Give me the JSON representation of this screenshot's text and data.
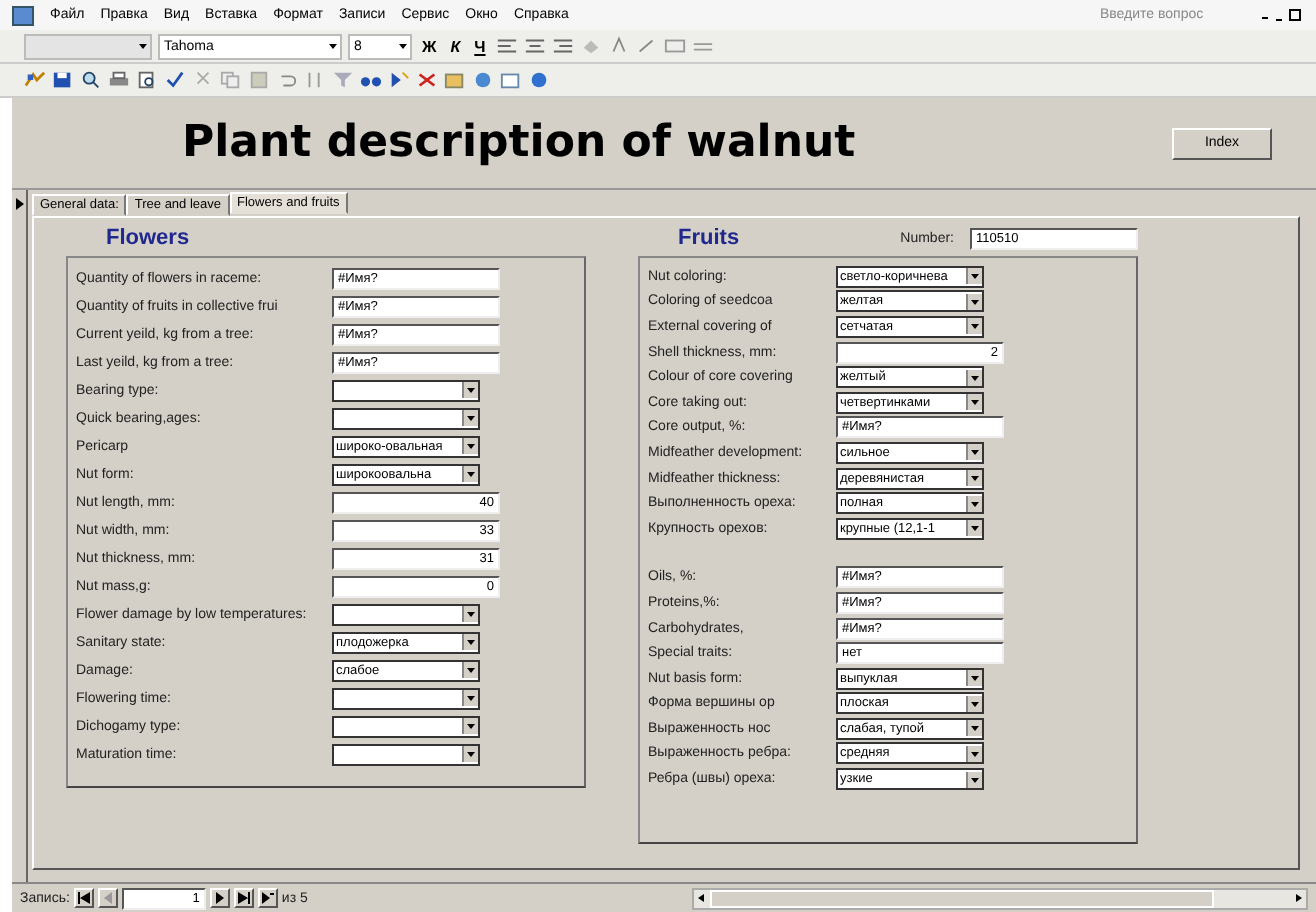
{
  "menu": [
    "Файл",
    "Правка",
    "Вид",
    "Вставка",
    "Формат",
    "Записи",
    "Сервис",
    "Окно",
    "Справка"
  ],
  "help_box": {
    "placeholder": "Введите вопрос"
  },
  "format_toolbar": {
    "font": "Tahoma",
    "size": "8",
    "style_buttons": [
      "Ж",
      "К",
      "Ч"
    ]
  },
  "form": {
    "title": "Plant description of walnut",
    "index_button": "Index",
    "tabs": [
      {
        "label": "General data:",
        "selected": false
      },
      {
        "label": "Tree and leave",
        "selected": false
      },
      {
        "label": "Flowers and fruits",
        "selected": true
      }
    ],
    "number": {
      "label": "Number:",
      "value": "110510"
    },
    "flowers": {
      "heading": "Flowers",
      "fields": [
        {
          "label": "Quantity of flowers in raceme:",
          "kind": "text",
          "value": "#Имя?"
        },
        {
          "label": "Quantity of fruits in collective frui",
          "kind": "text",
          "value": "#Имя?"
        },
        {
          "label": "Current yeild, kg from a tree:",
          "kind": "text",
          "value": "#Имя?"
        },
        {
          "label": "Last yeild, kg from a tree:",
          "kind": "text",
          "value": "#Имя?"
        },
        {
          "label": "Bearing type:",
          "kind": "combo"
        },
        {
          "label": "Quick bearing,ages:",
          "kind": "combo"
        },
        {
          "label": "Pericarp",
          "kind": "combo",
          "value": "широко-овальная"
        },
        {
          "label": "Nut form:",
          "kind": "combo",
          "value": "широкоовальна"
        },
        {
          "label": "Nut length, mm:",
          "kind": "number",
          "value": "40"
        },
        {
          "label": "Nut width, mm:",
          "kind": "number",
          "value": "33"
        },
        {
          "label": "Nut thickness, mm:",
          "kind": "number",
          "value": "31"
        },
        {
          "label": "Nut mass,g:",
          "kind": "number",
          "value": "0"
        },
        {
          "label": "Flower damage by low temperatures:",
          "kind": "combo"
        },
        {
          "label": "Sanitary state:",
          "kind": "combo",
          "value": "плодожерка"
        },
        {
          "label": "Damage:",
          "kind": "combo",
          "value": "слабое"
        },
        {
          "label": "Flowering time:",
          "kind": "combo"
        },
        {
          "label": "Dichogamy type:",
          "kind": "combo"
        },
        {
          "label": "Maturation time:",
          "kind": "combo"
        }
      ]
    },
    "fruits": {
      "heading": "Fruits",
      "fields": [
        {
          "label": "Nut coloring:",
          "kind": "combo",
          "value": "светло-коричнева"
        },
        {
          "label": "Coloring  of seedcoa",
          "kind": "combo",
          "value": "желтая"
        },
        {
          "label": "External covering of",
          "kind": "combo",
          "value": "сетчатая"
        },
        {
          "label": "Shell thickness, mm:",
          "kind": "number",
          "value": "2"
        },
        {
          "label": "Colour of core covering",
          "kind": "combo",
          "value": "желтый"
        },
        {
          "label": "Core taking out:",
          "kind": "combo",
          "value": "четвертинками"
        },
        {
          "label": "Core output, %:",
          "kind": "text",
          "value": "#Имя?"
        },
        {
          "label": "Midfeather development:",
          "kind": "combo",
          "value": "сильное"
        },
        {
          "label": "Midfeather thickness:",
          "kind": "combo",
          "value": "деревянистая"
        },
        {
          "label": "Выполненность ореха:",
          "kind": "combo",
          "value": "полная"
        },
        {
          "label": "Крупность орехов:",
          "kind": "combo",
          "value": "крупные (12,1-1"
        },
        {
          "label": "Oils, %:",
          "kind": "text",
          "value": "#Имя?",
          "gap_before": true
        },
        {
          "label": "Proteins,%:",
          "kind": "text",
          "value": "#Имя?"
        },
        {
          "label": "Carbohydrates,",
          "kind": "text",
          "value": "#Имя?"
        },
        {
          "label": "Special traits:",
          "kind": "text",
          "value": "нет"
        },
        {
          "label": "Nut basis form:",
          "kind": "combo",
          "value": "выпуклая"
        },
        {
          "label": "Форма вершины ор",
          "kind": "combo",
          "value": "плоская"
        },
        {
          "label": "Выраженность нос",
          "kind": "combo",
          "value": "слабая, тупой"
        },
        {
          "label": "Выраженность ребра:",
          "kind": "combo",
          "value": "средняя"
        },
        {
          "label": "Ребра (швы) ореха:",
          "kind": "combo",
          "value": "узкие"
        }
      ]
    }
  },
  "record_nav": {
    "label": "Запись:",
    "current": "1",
    "total": "из 5"
  }
}
